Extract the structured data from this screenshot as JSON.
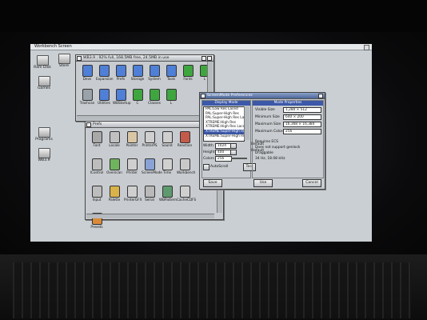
{
  "screen": {
    "title": "Workbench Screen"
  },
  "desktop_icons": [
    {
      "label": "Ram Disk"
    },
    {
      "label": "Store"
    },
    {
      "label": "Games"
    },
    {
      "label": "Programs"
    },
    {
      "label": "WB3.9"
    }
  ],
  "wb_window": {
    "title": "WB3.9 : 92% full, 168.5MB free, 24.5MB in use",
    "icons": [
      {
        "label": "Devs",
        "color": "#4f7fd6"
      },
      {
        "label": "Expansion",
        "color": "#4f7fd6"
      },
      {
        "label": "Prefs",
        "color": "#4f7fd6"
      },
      {
        "label": "Storage",
        "color": "#4f7fd6"
      },
      {
        "label": "System",
        "color": "#4f7fd6"
      },
      {
        "label": "Tools",
        "color": "#4f7fd6"
      },
      {
        "label": "Fonts",
        "color": "#3fa63f"
      },
      {
        "label": "L",
        "color": "#3fa63f"
      },
      {
        "label": "Trashcan",
        "color": "#9aa2aa"
      },
      {
        "label": "Utilities",
        "color": "#4f7fd6"
      },
      {
        "label": "WBStartup",
        "color": "#4f7fd6"
      },
      {
        "label": "C",
        "color": "#3fa63f"
      },
      {
        "label": "Classes",
        "color": "#3fa63f"
      },
      {
        "label": "L",
        "color": "#3fa63f"
      }
    ]
  },
  "prefs_window": {
    "title": "Prefs",
    "icons": [
      {
        "label": "Font",
        "color": "#a9a9a9"
      },
      {
        "label": "Locale",
        "color": "#c0c0c0"
      },
      {
        "label": "Pointer",
        "color": "#d9c6a4"
      },
      {
        "label": "PrinterPS",
        "color": "#cfcfcf"
      },
      {
        "label": "Sound",
        "color": "#cfcfcf"
      },
      {
        "label": "Reaction",
        "color": "#c45b4a"
      },
      {
        "label": "IControl",
        "color": "#bdbdbd"
      },
      {
        "label": "Overscan",
        "color": "#6fb35d"
      },
      {
        "label": "Printer",
        "color": "#cfcfcf"
      },
      {
        "label": "ScreenMode",
        "color": "#8aa3d6"
      },
      {
        "label": "Time",
        "color": "#d0d0d0"
      },
      {
        "label": "Workbench",
        "color": "#c9c9c9"
      },
      {
        "label": "Input",
        "color": "#bdbdbd"
      },
      {
        "label": "Palette",
        "color": "#d9b24a"
      },
      {
        "label": "PrinterGFX",
        "color": "#cfcfcf"
      },
      {
        "label": "Serial",
        "color": "#b9b9b9"
      },
      {
        "label": "WBPattern",
        "color": "#5f9a6f"
      },
      {
        "label": "CacheCDFS",
        "color": "#cfcfcf"
      },
      {
        "label": "Presets",
        "color": "#d98a3a"
      }
    ]
  },
  "screenmode_window": {
    "title": "ScreenMode Preferences",
    "display_mode_header": "Display Mode",
    "mode_list": [
      "PAL:Low Res Laced",
      "PAL:Super-High Res",
      "PAL:Super-High Res Laced",
      "XTREME:High Res",
      "XTREME:High Res Laced",
      "XTREME:Super-High Res",
      "XTREME:Super-High Res La"
    ],
    "selected_index": 5,
    "width_label": "Width",
    "width_value": "1024",
    "height_label": "Height",
    "height_value": "400",
    "colors_label": "Colors",
    "colors_value": "256",
    "default_label": "Default",
    "autoscroll_label": "AutoScroll",
    "test_label": "Test",
    "props_header": "Mode Properties",
    "visible_size_label": "Visible Size",
    "visible_size_value": "1,280 × 512",
    "minimum_size_label": "Minimum Size",
    "minimum_size_value": "640 × 200",
    "maximum_size_label": "Maximum Size",
    "maximum_size_value": "16,368 × 16,384",
    "maximum_colors_label": "Maximum Colors",
    "maximum_colors_value": "256",
    "prop1": "Requires ECS",
    "prop2": "Does not support genlock",
    "prop3": "Draggable",
    "prop4": "34 Hz, 18.08 kHz",
    "save_label": "Save",
    "use_label": "Use",
    "cancel_label": "Cancel"
  }
}
